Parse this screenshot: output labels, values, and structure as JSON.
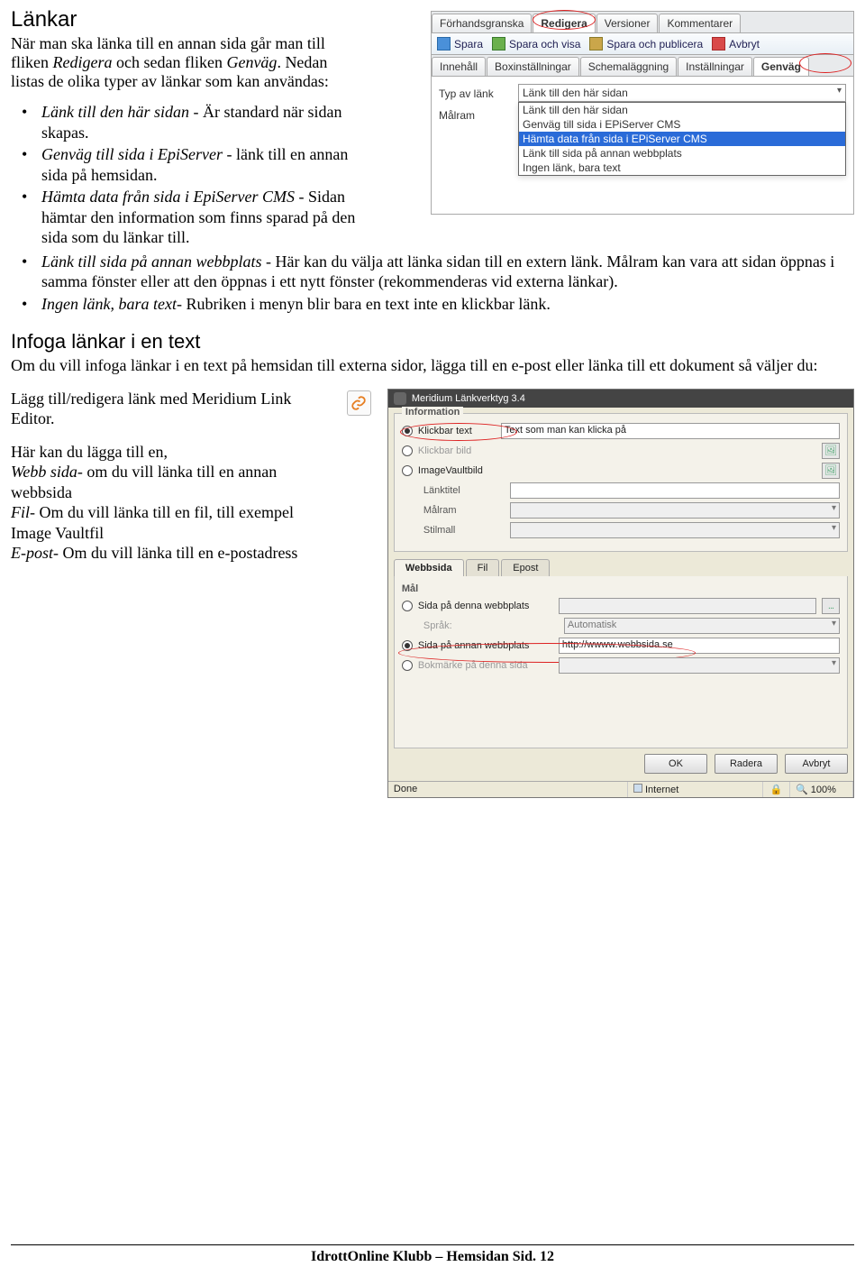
{
  "doc": {
    "h1": "Länkar",
    "intro1": "När man ska länka till en annan sida går man till fliken ",
    "intro1_i1": "Redigera",
    "intro1_mid": " och sedan fliken ",
    "intro1_i2": "Genväg",
    "intro1_end": ". Nedan listas  de olika  typer av länkar som kan användas:",
    "b1_i": "Länk till den här sidan",
    "b1_t": " - Är standard när sidan skapas.",
    "b2_i": "Genväg till sida i EpiServer",
    "b2_t": " - länk till en annan sida på hemsidan.",
    "b3_i": "Hämta data från sida i EpiServer CMS",
    "b3_t": " - Sidan hämtar den information som finns sparad på den sida som du länkar till.",
    "b4_i": "Länk till sida på annan webbplats",
    "b4_t": " - Här kan du välja att länka sidan till en extern länk. Målram kan vara att sidan öppnas i samma fönster eller att den öppnas i ett nytt fönster (rekommenderas vid externa länkar).",
    "b5_i": "Ingen länk, bara text",
    "b5_t": "- Rubriken i menyn blir bara en text inte en klickbar länk.",
    "h2": "Infoga länkar i en text",
    "infoga_p": "Om du vill infoga länkar i en text på hemsidan till externa sidor, lägga till en e-post eller länka till ett dokument så väljer du:",
    "left_p1": "Lägg till/redigera länk med Meridium Link Editor.",
    "left_p2a": "Här kan du lägga till en,",
    "left_p2b_i": "Webb sida",
    "left_p2b_t": "- om du vill länka till en annan webbsida",
    "left_p2c_i": "Fil",
    "left_p2c_t": "- Om du vill länka till en fil, till exempel Image Vaultfil",
    "left_p2d_i": "E-post",
    "left_p2d_t": "- Om du vill länka till en e-postadress"
  },
  "shot1": {
    "tabs1": [
      "Förhandsgranska",
      "Redigera",
      "Versioner",
      "Kommentarer"
    ],
    "tabs1_active": 1,
    "toolbar": {
      "save": "Spara",
      "saveShow": "Spara och visa",
      "savePub": "Spara och publicera",
      "cancel": "Avbryt"
    },
    "tabs2": [
      "Innehåll",
      "Boxinställningar",
      "Schemaläggning",
      "Inställningar",
      "Genväg"
    ],
    "tabs2_active": 4,
    "row1_label": "Typ av länk",
    "row2_label": "Målram",
    "sel_value": "Länk till den här sidan",
    "options": [
      "Länk till den här sidan",
      "Genväg till sida i EPiServer CMS",
      "Hämta data från sida i EPiServer CMS",
      "Länk till sida på annan webbplats",
      "Ingen länk, bara text"
    ],
    "options_selected": 2
  },
  "shot2": {
    "title": "Meridium Länkverktyg 3.4",
    "group_info": "Information",
    "radio1": "Klickbar text",
    "radio1_val": "Text som man kan klicka på",
    "radio2": "Klickbar bild",
    "radio3": "ImageVaultbild",
    "lbl_title": "Länktitel",
    "lbl_target": "Målram",
    "lbl_style": "Stilmall",
    "tabs": [
      "Webbsida",
      "Fil",
      "Epost"
    ],
    "tabs_active": 0,
    "mal_h": "Mål",
    "mal1": "Sida på denna webbplats",
    "mal_lang": "Språk:",
    "mal_lang_val": "Automatisk",
    "mal2": "Sida på annan webbplats",
    "mal2_val": "http://wwww.webbsida.se",
    "mal3": "Bokmärke på denna sida",
    "btns": {
      "ok": "OK",
      "del": "Radera",
      "cancel": "Avbryt"
    },
    "status": {
      "done": "Done",
      "zone": "Internet",
      "zoom": "100%"
    }
  },
  "footer": "IdrottOnline Klubb – Hemsidan Sid. 12"
}
